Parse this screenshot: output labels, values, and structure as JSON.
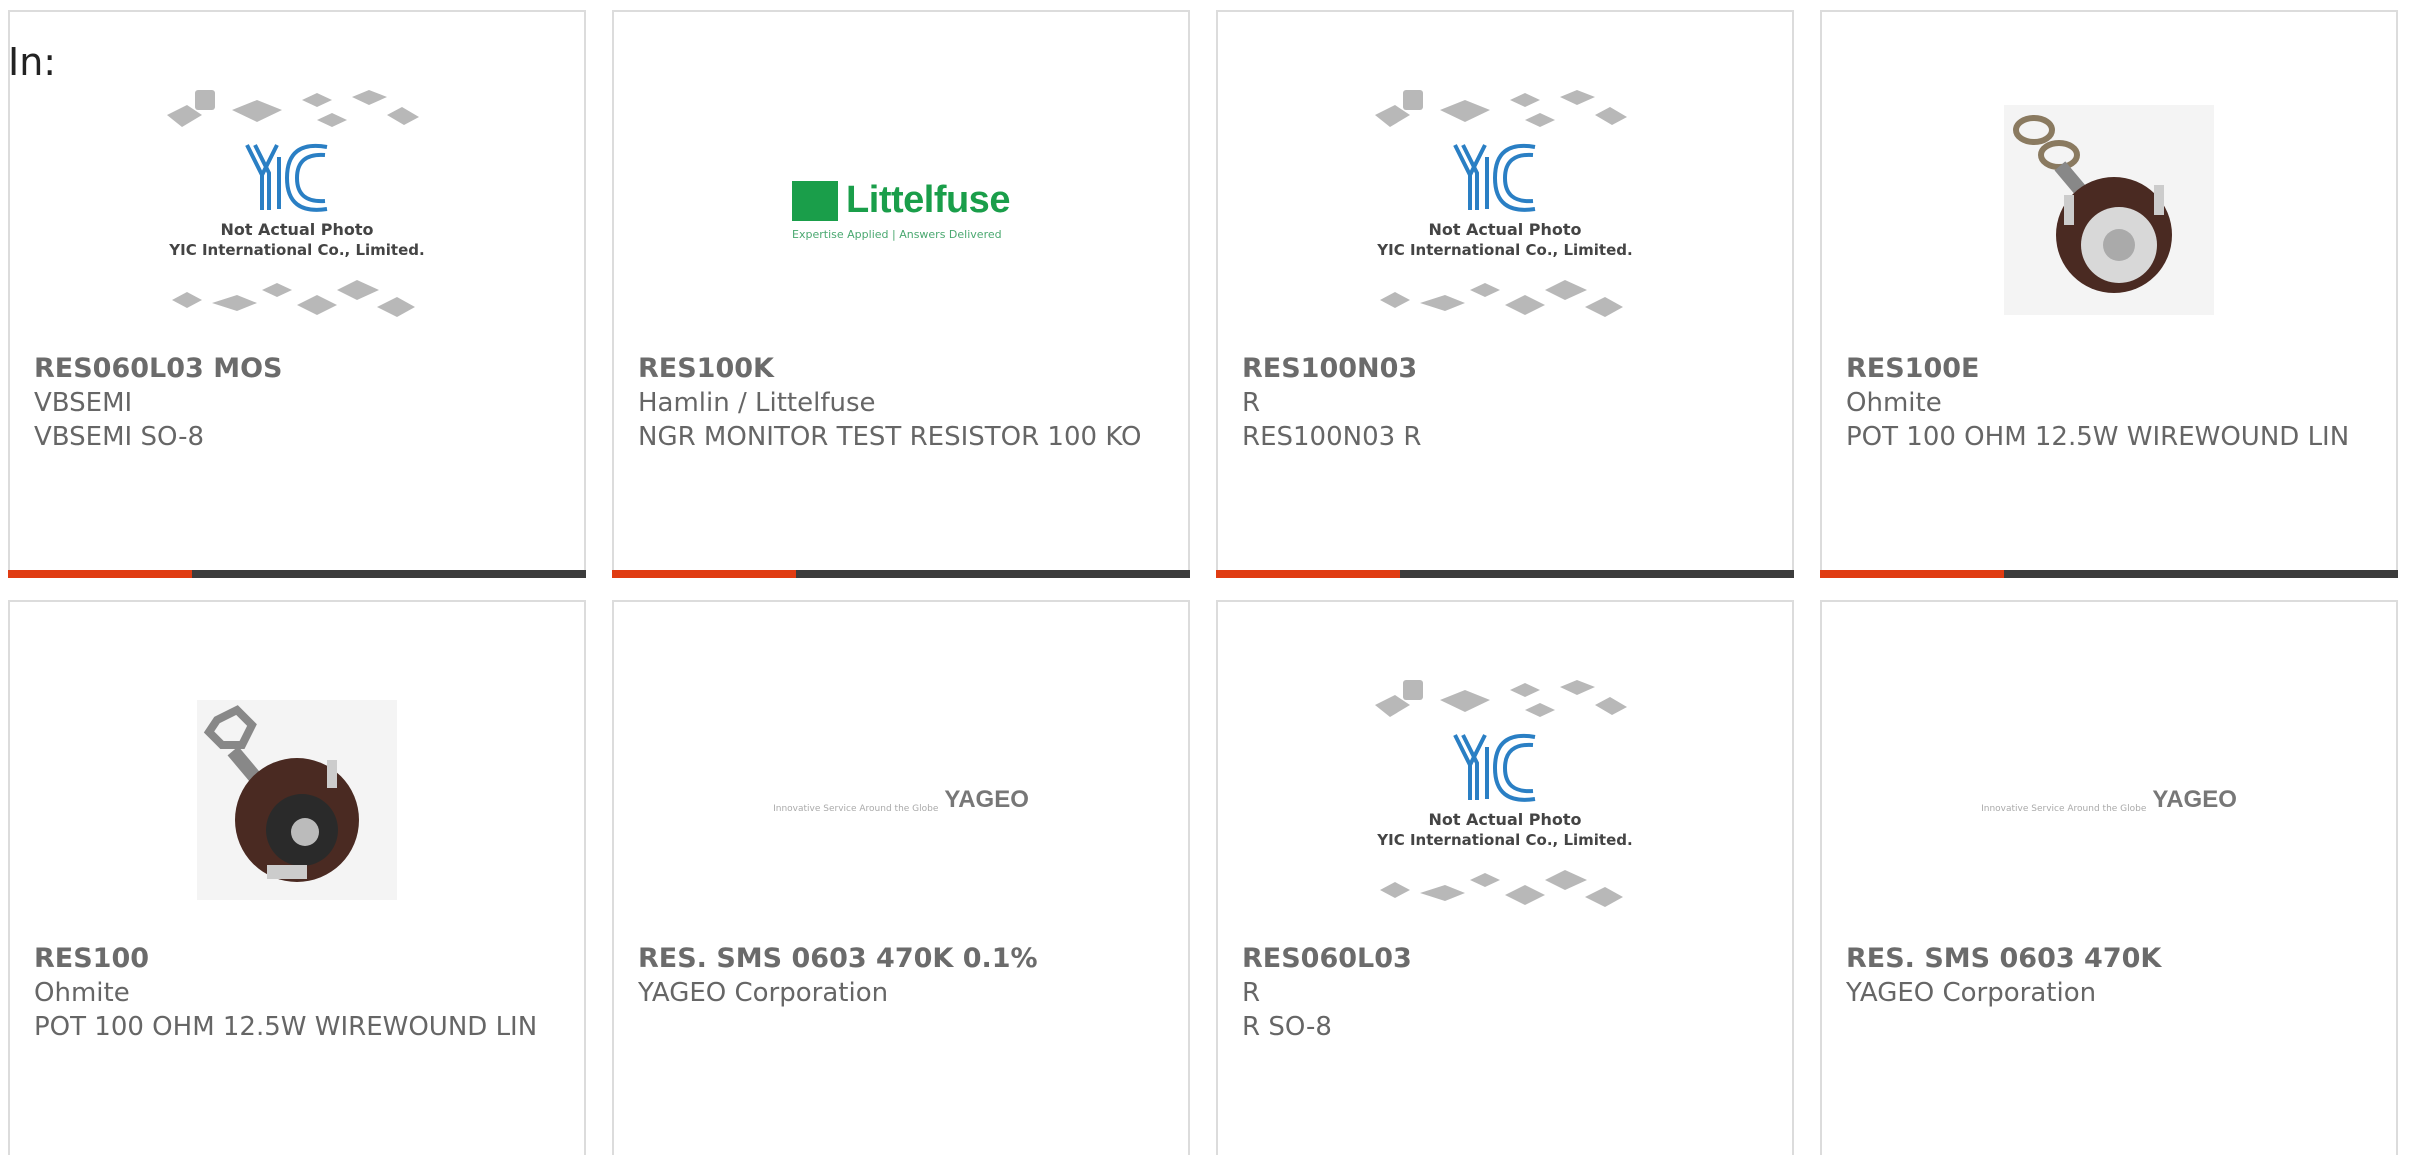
{
  "page": {
    "in_label": "In:"
  },
  "colors": {
    "accent": "#e03c12",
    "bar": "#3c3c3c",
    "border": "#dcdcdc"
  },
  "cards": [
    {
      "part": "RES060L03 MOS",
      "mfr": "VBSEMI",
      "desc": "VBSEMI SO-8",
      "image": "yic-not-actual-photo",
      "yic_line1": "Not Actual Photo",
      "yic_line2": "YIC International Co., Limited."
    },
    {
      "part": "RES100K",
      "mfr": "Hamlin / Littelfuse",
      "desc": "NGR MONITOR TEST RESISTOR 100 KO",
      "image": "littelfuse-logo",
      "logo_word": "Littelfuse",
      "logo_tag": "Expertise Applied | Answers Delivered"
    },
    {
      "part": "RES100N03",
      "mfr": "R",
      "desc": "RES100N03 R",
      "image": "yic-not-actual-photo",
      "yic_line1": "Not Actual Photo",
      "yic_line2": "YIC International Co., Limited."
    },
    {
      "part": "RES100E",
      "mfr": "Ohmite",
      "desc": "POT 100 OHM 12.5W WIREWOUND LIN",
      "image": "potentiometer-photo"
    },
    {
      "part": "RES100",
      "mfr": "Ohmite",
      "desc": "POT 100 OHM 12.5W WIREWOUND LIN",
      "image": "potentiometer-photo"
    },
    {
      "part": "RES. SMS 0603 470K 0.1%",
      "mfr": "YAGEO Corporation",
      "desc": "",
      "image": "yageo-logo",
      "logo_word": "YAGEO",
      "logo_tag": "Innovative Service Around the Globe"
    },
    {
      "part": "RES060L03",
      "mfr": "R",
      "desc": "R SO-8",
      "image": "yic-not-actual-photo",
      "yic_line1": "Not Actual Photo",
      "yic_line2": "YIC International Co., Limited."
    },
    {
      "part": "RES. SMS 0603 470K",
      "mfr": "YAGEO Corporation",
      "desc": "",
      "image": "yageo-logo",
      "logo_word": "YAGEO",
      "logo_tag": "Innovative Service Around the Globe"
    }
  ]
}
